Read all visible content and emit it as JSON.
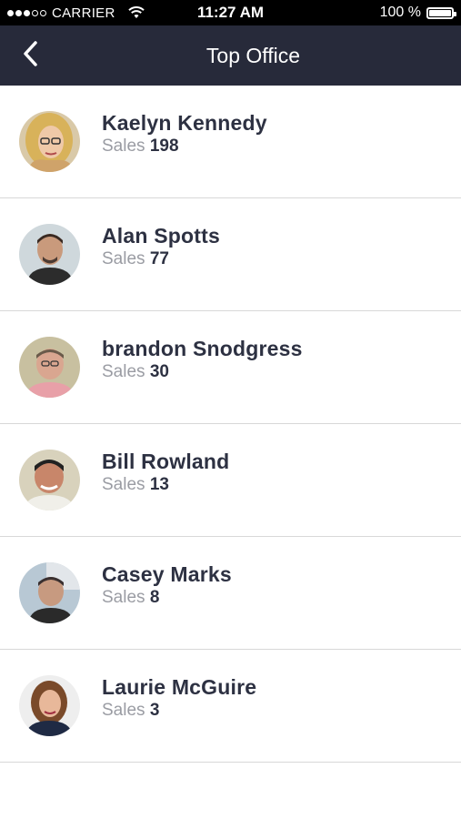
{
  "status_bar": {
    "carrier": "CARRIER",
    "time": "11:27 AM",
    "battery": "100 %",
    "signal_filled": 3,
    "signal_total": 5
  },
  "nav": {
    "title": "Top Office",
    "back_icon": "chevron-left-icon"
  },
  "sales_label": "Sales",
  "people": [
    {
      "name": "Kaelyn Kennedy",
      "sales": "198"
    },
    {
      "name": "Alan Spotts",
      "sales": "77"
    },
    {
      "name": "brandon Snodgress",
      "sales": "30"
    },
    {
      "name": "Bill Rowland",
      "sales": "13"
    },
    {
      "name": "Casey Marks",
      "sales": "8"
    },
    {
      "name": "Laurie McGuire",
      "sales": "3"
    }
  ],
  "colors": {
    "nav_background": "#272a3a",
    "name_text": "#2d3142",
    "sales_label": "#9a9ca3",
    "divider": "#d8d8d8"
  }
}
